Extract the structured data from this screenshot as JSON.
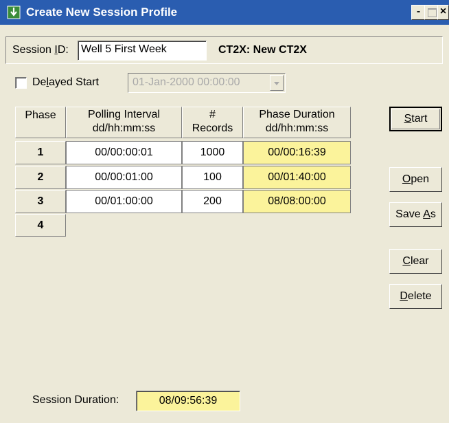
{
  "window": {
    "title": "Create New Session Profile",
    "icon": "download-arrow-icon",
    "controls": {
      "minimize": "-",
      "close": "×"
    }
  },
  "session": {
    "id_label_pre": "Session ",
    "id_label_key": "I",
    "id_label_post": "D:",
    "id_value": "Well 5 First Week",
    "device_label": "CT2X: New CT2X"
  },
  "delayed_start": {
    "label_pre": "De",
    "label_key": "l",
    "label_post": "ayed Start",
    "checked": false,
    "datetime": "01-Jan-2000  00:00:00"
  },
  "table": {
    "headers": [
      {
        "line1": "Phase",
        "line2": ""
      },
      {
        "line1": "Polling Interval",
        "line2": "dd/hh:mm:ss"
      },
      {
        "line1": "#",
        "line2": "Records"
      },
      {
        "line1": "Phase Duration",
        "line2": "dd/hh:mm:ss"
      }
    ],
    "rows": [
      {
        "phase": "1",
        "interval": "00/00:00:01",
        "records": "1000",
        "duration": "00/00:16:39"
      },
      {
        "phase": "2",
        "interval": "00/00:01:00",
        "records": "100",
        "duration": "00/01:40:00"
      },
      {
        "phase": "3",
        "interval": "00/01:00:00",
        "records": "200",
        "duration": "08/08:00:00"
      },
      {
        "phase": "4"
      }
    ]
  },
  "buttons": {
    "start": {
      "key": "S",
      "rest": "tart"
    },
    "open": {
      "key": "O",
      "rest": "pen"
    },
    "save_as": {
      "pre": "Save ",
      "key": "A",
      "rest": "s"
    },
    "clear": {
      "key": "C",
      "rest": "lear"
    },
    "delete": {
      "key": "D",
      "rest": "elete"
    }
  },
  "session_duration": {
    "label": "Session Duration:",
    "value": "08/09:56:39"
  },
  "colors": {
    "titlebar": "#2a5db0",
    "window_bg": "#ece9d8",
    "computed_field": "#fbf39b"
  }
}
